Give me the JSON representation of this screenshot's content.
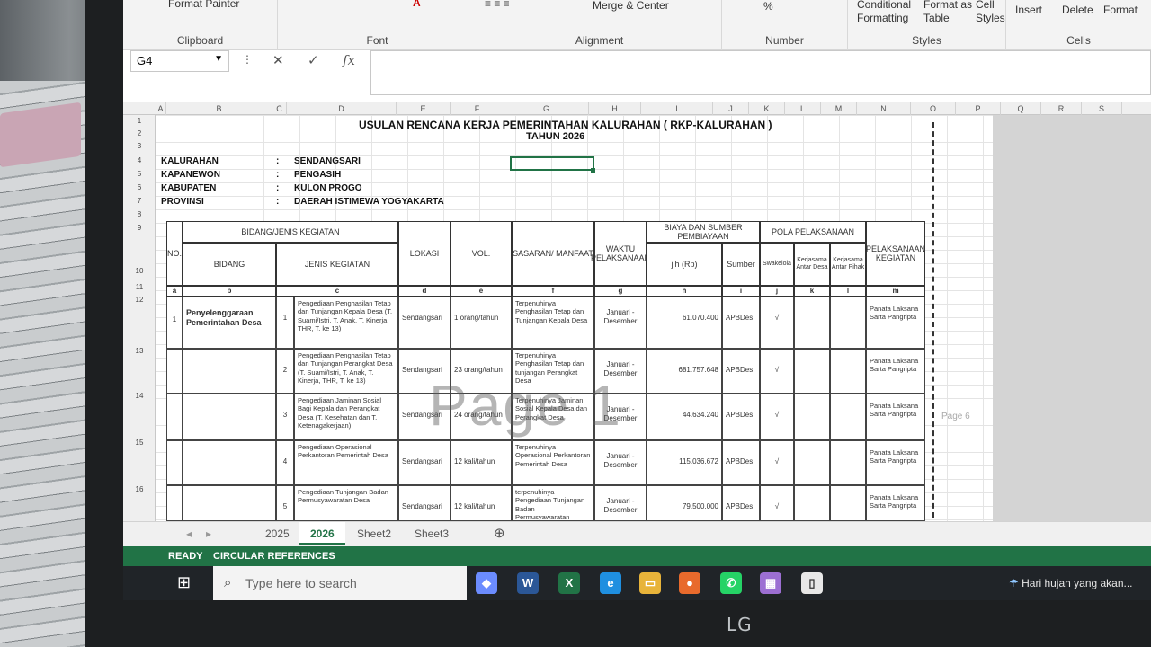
{
  "ribbon": {
    "format_painter": "Format Painter",
    "clipboard": "Clipboard",
    "font": "Font",
    "alignment": "Alignment",
    "merge_center": "Merge & Center",
    "number": "Number",
    "percent": "%",
    "conditional": "Conditional",
    "formatting": "Formatting",
    "format_as": "Format as",
    "table": "Table",
    "cell": "Cell",
    "styles_btn": "Styles",
    "styles": "Styles",
    "insert": "Insert",
    "delete": "Delete",
    "format": "Format",
    "cells": "Cells"
  },
  "formula": {
    "name_box": "G4",
    "fx": "fx",
    "cancel": "✕",
    "enter": "✓",
    "value": ""
  },
  "columns": [
    "A",
    "B",
    "C",
    "D",
    "E",
    "F",
    "G",
    "H",
    "I",
    "J",
    "K",
    "L",
    "M",
    "N",
    "O",
    "P",
    "Q",
    "R",
    "S"
  ],
  "rows": [
    "1",
    "2",
    "3",
    "4",
    "5",
    "6",
    "7",
    "8",
    "9",
    "10",
    "11",
    "12",
    "13",
    "14",
    "15",
    "16"
  ],
  "sheet": {
    "title": "USULAN RENCANA KERJA PEMERINTAHAN KALURAHAN ( RKP-KALURAHAN )",
    "year": "TAHUN 2026",
    "info": [
      {
        "label": "KALURAHAN",
        "sep": ":",
        "value": "SENDANGSARI"
      },
      {
        "label": "KAPANEWON",
        "sep": ":",
        "value": "PENGASIH"
      },
      {
        "label": "KABUPATEN",
        "sep": ":",
        "value": "KULON PROGO"
      },
      {
        "label": "PROVINSI",
        "sep": ":",
        "value": "DAERAH ISTIMEWA YOGYAKARTA"
      }
    ],
    "headers": {
      "no": "NO.",
      "bidang_jenis": "BIDANG/JENIS KEGIATAN",
      "bidang": "BIDANG",
      "jenis": "JENIS KEGIATAN",
      "lokasi": "LOKASI",
      "vol": "VOL.",
      "sasaran": "SASARAN/ MANFAAT",
      "waktu": "WAKTU PELAKSANAAN",
      "biaya": "BIAYA DAN SUMBER PEMBIAYAAN",
      "jumlah": "jlh (Rp)",
      "sumber": "Sumber",
      "pola": "POLA PELAKSANAAN",
      "swakelola": "Swakelola",
      "kerjasama_desa": "Kerjasama Antar Desa",
      "kerjasama_pihak": "Kerjasama Antar Pihak",
      "pelaksana": "PELAKSANAAN KEGIATAN"
    },
    "letters": [
      "a",
      "b",
      "c",
      "d",
      "e",
      "f",
      "g",
      "h",
      "i",
      "j",
      "k",
      "l",
      "m"
    ],
    "bidang_row": {
      "no": "1",
      "bidang": "Penyelenggaraan Pemerintahan Desa"
    },
    "items": [
      {
        "no": "1",
        "jenis": "Pengediaan Penghasilan Tetap dan Tunjangan Kepala Desa (T. Suami/Istri, T. Anak, T. Kinerja, THR, T. ke 13)",
        "lokasi": "Sendangsari",
        "vol": "1 orang/tahun",
        "sasaran": "Terpenuhinya Penghasilan Tetap dan Tunjangan Kepala Desa",
        "waktu": "Januari - Desember",
        "jumlah": "61.070.400",
        "sumber": "APBDes",
        "swakelola": "√",
        "pelaksana": "Panata Laksana Sarta Pangripta"
      },
      {
        "no": "2",
        "jenis": "Pengediaan Penghasilan Tetap dan Tunjangan Perangkat Desa (T. Suami/Istri, T. Anak, T. Kinerja, THR, T. ke 13)",
        "lokasi": "Sendangsari",
        "vol": "23 orang/tahun",
        "sasaran": "Terpenuhinya Penghasilan Tetap dan tunjangan Perangkat Desa",
        "waktu": "Januari - Desember",
        "jumlah": "681.757.648",
        "sumber": "APBDes",
        "swakelola": "√",
        "pelaksana": "Panata Laksana Sarta Pangripta"
      },
      {
        "no": "3",
        "jenis": "Pengediaan Jaminan Sosial Bagi Kepala dan Perangkat Desa (T. Kesehatan dan T. Ketenagakerjaan)",
        "lokasi": "Sendangsari",
        "vol": "24 orang/tahun",
        "sasaran": "Terpenuhinya Jaminan Sosial Kepala Desa dan Perangkat Desa",
        "waktu": "Januari - Desember",
        "jumlah": "44.634.240",
        "sumber": "APBDes",
        "swakelola": "√",
        "pelaksana": "Panata Laksana Sarta Pangripta"
      },
      {
        "no": "4",
        "jenis": "Pengediaan Operasional Perkantoran Pemerintah Desa",
        "lokasi": "Sendangsari",
        "vol": "12 kali/tahun",
        "sasaran": "Terpenuhinya Operasional Perkantoran Pemerintah Desa",
        "waktu": "Januari - Desember",
        "jumlah": "115.036.672",
        "sumber": "APBDes",
        "swakelola": "√",
        "pelaksana": "Panata Laksana Sarta Pangripta"
      },
      {
        "no": "5",
        "jenis": "Pengediaan Tunjangan Badan Permusyawaratan Desa",
        "lokasi": "Sendangsari",
        "vol": "12 kali/tahun",
        "sasaran": "terpenuhinya Pengediaan Tunjangan Badan Permusyawaratan",
        "waktu": "Januari - Desember",
        "jumlah": "79.500.000",
        "sumber": "APBDes",
        "swakelola": "√",
        "pelaksana": "Panata Laksana Sarta Pangripta"
      }
    ],
    "watermark": "Page 1",
    "page6": "Page 6"
  },
  "tabs": [
    "2025",
    "2026",
    "Sheet2",
    "Sheet3"
  ],
  "status": {
    "ready": "READY",
    "circular": "CIRCULAR REFERENCES"
  },
  "taskbar": {
    "search": "Type here to search",
    "weather": "Hari hujan yang akan..."
  },
  "monitor_logo": "LG",
  "colors": {
    "excel_green": "#217346",
    "taskbar": "#202428"
  }
}
